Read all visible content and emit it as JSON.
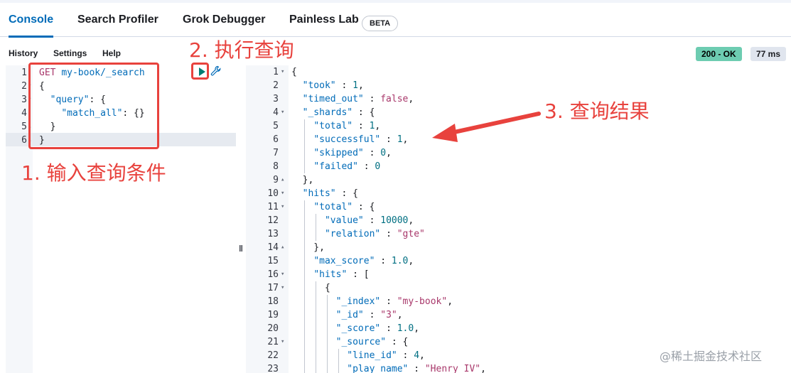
{
  "tabs": [
    {
      "label": "Console"
    },
    {
      "label": "Search Profiler"
    },
    {
      "label": "Grok Debugger"
    },
    {
      "label": "Painless Lab"
    }
  ],
  "beta_label": "BETA",
  "menu": {
    "history": "History",
    "settings": "Settings",
    "help": "Help"
  },
  "status": {
    "code": "200 - OK",
    "time": "77 ms"
  },
  "request_lines": [
    "GET my-book/_search",
    "{",
    "  \"query\": {",
    "    \"match_all\": {}",
    "  }",
    "}"
  ],
  "response_lines": [
    "{",
    "  \"took\" : 1,",
    "  \"timed_out\" : false,",
    "  \"_shards\" : {",
    "    \"total\" : 1,",
    "    \"successful\" : 1,",
    "    \"skipped\" : 0,",
    "    \"failed\" : 0",
    "  },",
    "  \"hits\" : {",
    "    \"total\" : {",
    "      \"value\" : 10000,",
    "      \"relation\" : \"gte\"",
    "    },",
    "    \"max_score\" : 1.0,",
    "    \"hits\" : [",
    "      {",
    "        \"_index\" : \"my-book\",",
    "        \"_id\" : \"3\",",
    "        \"_score\" : 1.0,",
    "        \"_source\" : {",
    "          \"line_id\" : 4,",
    "          \"play_name\" : \"Henry IV\","
  ],
  "annotations": {
    "step1": "1. 输入查询条件",
    "step2": "2. 执行查询",
    "step3": "3. 查询结果"
  },
  "watermark": "@稀土掘金技术社区",
  "colors": {
    "accent": "#006bb8",
    "ok": "#6dccb1",
    "annotation": "#e8423d"
  },
  "icons": {
    "run": "play-icon",
    "settings": "wrench-icon",
    "resize": "drag-handle-icon"
  }
}
